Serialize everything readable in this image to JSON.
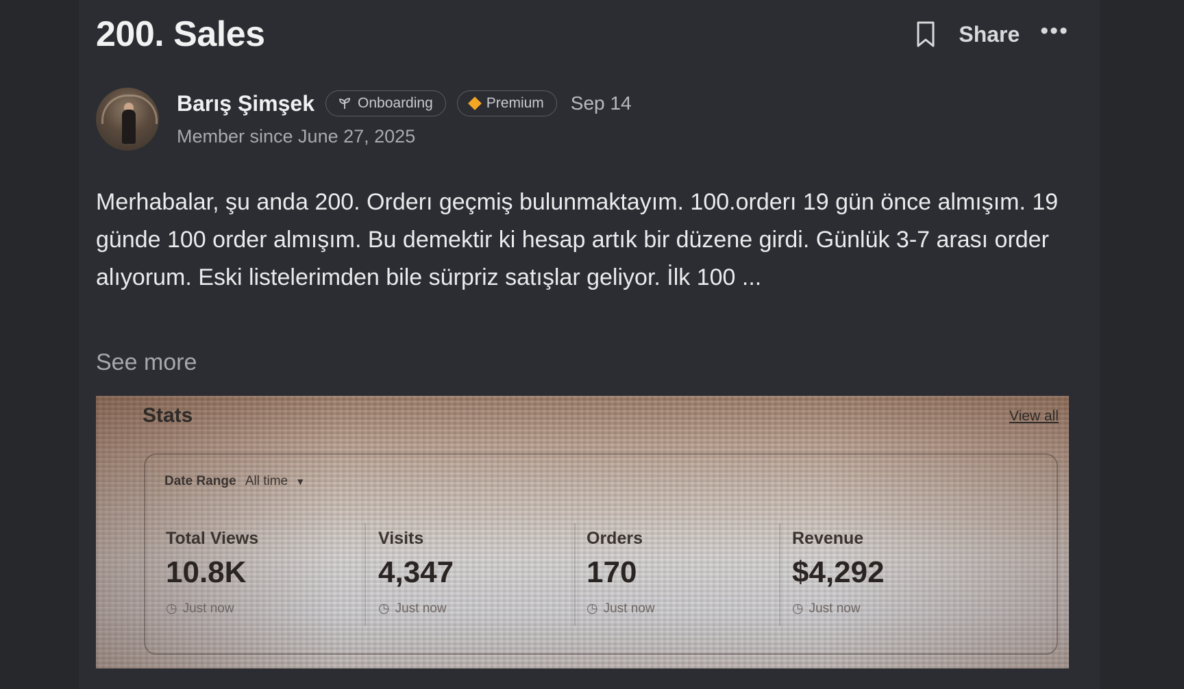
{
  "post": {
    "title": "200. Sales",
    "share_label": "Share",
    "more_label": "•••"
  },
  "author": {
    "name": "Barış Şimşek",
    "badges": {
      "onboarding": "Onboarding",
      "premium": "Premium"
    },
    "date": "Sep 14",
    "member_since": "Member since June 27, 2025"
  },
  "body": {
    "text": "Merhabalar, şu anda 200. Orderı geçmiş bulunmaktayım. 100.orderı 19 gün önce almışım. 19 günde 100 order almışım. Bu demektir ki hesap artık bir düzene girdi. Günlük 3-7 arası order alıyorum. Eski listelerimden bile sürpriz satışlar geliyor. İlk 100 ...",
    "see_more": "See more"
  },
  "stats_image": {
    "title": "Stats",
    "view_all": "View all",
    "date_range_label": "Date Range",
    "date_range_value": "All time",
    "metrics": [
      {
        "label": "Total Views",
        "value": "10.8K",
        "time": "Just now"
      },
      {
        "label": "Visits",
        "value": "4,347",
        "time": "Just now"
      },
      {
        "label": "Orders",
        "value": "170",
        "time": "Just now"
      },
      {
        "label": "Revenue",
        "value": "$4,292",
        "time": "Just now"
      }
    ]
  },
  "icons": {
    "bookmark": "bookmark-icon",
    "onboarding": "sprout-icon",
    "premium": "diamond-icon",
    "clock": "clock-icon",
    "caret": "caret-down-icon"
  },
  "colors": {
    "background": "#26282c",
    "panel": "#2b2d32",
    "premium_accent": "#f5a623"
  }
}
